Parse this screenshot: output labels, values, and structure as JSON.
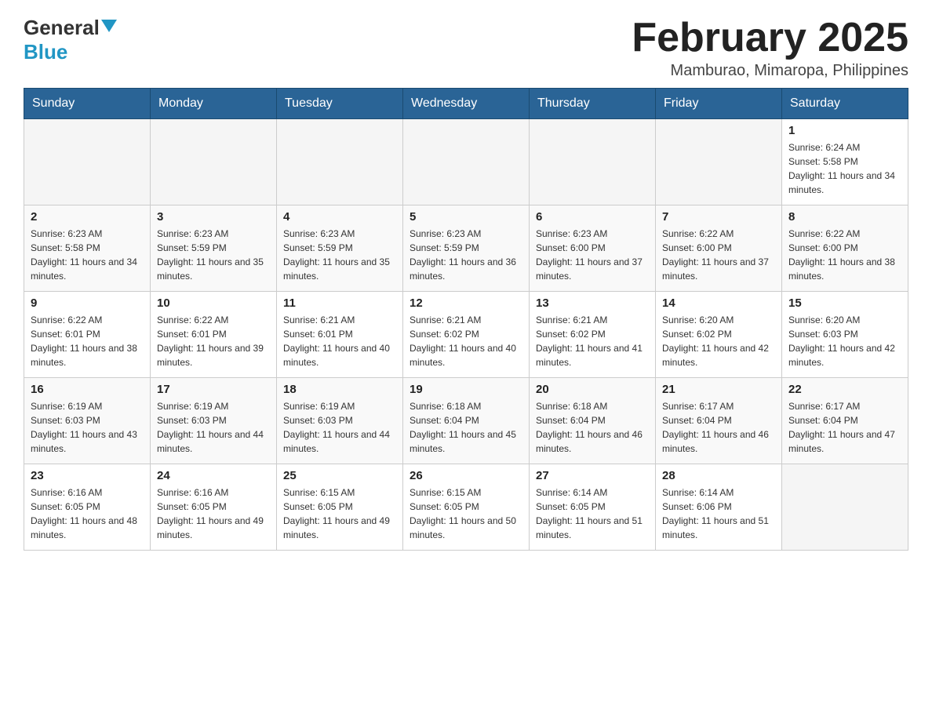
{
  "header": {
    "logo": {
      "word1": "General",
      "word2": "Blue"
    },
    "title": "February 2025",
    "location": "Mamburao, Mimaropa, Philippines"
  },
  "weekdays": [
    "Sunday",
    "Monday",
    "Tuesday",
    "Wednesday",
    "Thursday",
    "Friday",
    "Saturday"
  ],
  "weeks": [
    [
      {
        "day": "",
        "info": ""
      },
      {
        "day": "",
        "info": ""
      },
      {
        "day": "",
        "info": ""
      },
      {
        "day": "",
        "info": ""
      },
      {
        "day": "",
        "info": ""
      },
      {
        "day": "",
        "info": ""
      },
      {
        "day": "1",
        "info": "Sunrise: 6:24 AM\nSunset: 5:58 PM\nDaylight: 11 hours and 34 minutes."
      }
    ],
    [
      {
        "day": "2",
        "info": "Sunrise: 6:23 AM\nSunset: 5:58 PM\nDaylight: 11 hours and 34 minutes."
      },
      {
        "day": "3",
        "info": "Sunrise: 6:23 AM\nSunset: 5:59 PM\nDaylight: 11 hours and 35 minutes."
      },
      {
        "day": "4",
        "info": "Sunrise: 6:23 AM\nSunset: 5:59 PM\nDaylight: 11 hours and 35 minutes."
      },
      {
        "day": "5",
        "info": "Sunrise: 6:23 AM\nSunset: 5:59 PM\nDaylight: 11 hours and 36 minutes."
      },
      {
        "day": "6",
        "info": "Sunrise: 6:23 AM\nSunset: 6:00 PM\nDaylight: 11 hours and 37 minutes."
      },
      {
        "day": "7",
        "info": "Sunrise: 6:22 AM\nSunset: 6:00 PM\nDaylight: 11 hours and 37 minutes."
      },
      {
        "day": "8",
        "info": "Sunrise: 6:22 AM\nSunset: 6:00 PM\nDaylight: 11 hours and 38 minutes."
      }
    ],
    [
      {
        "day": "9",
        "info": "Sunrise: 6:22 AM\nSunset: 6:01 PM\nDaylight: 11 hours and 38 minutes."
      },
      {
        "day": "10",
        "info": "Sunrise: 6:22 AM\nSunset: 6:01 PM\nDaylight: 11 hours and 39 minutes."
      },
      {
        "day": "11",
        "info": "Sunrise: 6:21 AM\nSunset: 6:01 PM\nDaylight: 11 hours and 40 minutes."
      },
      {
        "day": "12",
        "info": "Sunrise: 6:21 AM\nSunset: 6:02 PM\nDaylight: 11 hours and 40 minutes."
      },
      {
        "day": "13",
        "info": "Sunrise: 6:21 AM\nSunset: 6:02 PM\nDaylight: 11 hours and 41 minutes."
      },
      {
        "day": "14",
        "info": "Sunrise: 6:20 AM\nSunset: 6:02 PM\nDaylight: 11 hours and 42 minutes."
      },
      {
        "day": "15",
        "info": "Sunrise: 6:20 AM\nSunset: 6:03 PM\nDaylight: 11 hours and 42 minutes."
      }
    ],
    [
      {
        "day": "16",
        "info": "Sunrise: 6:19 AM\nSunset: 6:03 PM\nDaylight: 11 hours and 43 minutes."
      },
      {
        "day": "17",
        "info": "Sunrise: 6:19 AM\nSunset: 6:03 PM\nDaylight: 11 hours and 44 minutes."
      },
      {
        "day": "18",
        "info": "Sunrise: 6:19 AM\nSunset: 6:03 PM\nDaylight: 11 hours and 44 minutes."
      },
      {
        "day": "19",
        "info": "Sunrise: 6:18 AM\nSunset: 6:04 PM\nDaylight: 11 hours and 45 minutes."
      },
      {
        "day": "20",
        "info": "Sunrise: 6:18 AM\nSunset: 6:04 PM\nDaylight: 11 hours and 46 minutes."
      },
      {
        "day": "21",
        "info": "Sunrise: 6:17 AM\nSunset: 6:04 PM\nDaylight: 11 hours and 46 minutes."
      },
      {
        "day": "22",
        "info": "Sunrise: 6:17 AM\nSunset: 6:04 PM\nDaylight: 11 hours and 47 minutes."
      }
    ],
    [
      {
        "day": "23",
        "info": "Sunrise: 6:16 AM\nSunset: 6:05 PM\nDaylight: 11 hours and 48 minutes."
      },
      {
        "day": "24",
        "info": "Sunrise: 6:16 AM\nSunset: 6:05 PM\nDaylight: 11 hours and 49 minutes."
      },
      {
        "day": "25",
        "info": "Sunrise: 6:15 AM\nSunset: 6:05 PM\nDaylight: 11 hours and 49 minutes."
      },
      {
        "day": "26",
        "info": "Sunrise: 6:15 AM\nSunset: 6:05 PM\nDaylight: 11 hours and 50 minutes."
      },
      {
        "day": "27",
        "info": "Sunrise: 6:14 AM\nSunset: 6:05 PM\nDaylight: 11 hours and 51 minutes."
      },
      {
        "day": "28",
        "info": "Sunrise: 6:14 AM\nSunset: 6:06 PM\nDaylight: 11 hours and 51 minutes."
      },
      {
        "day": "",
        "info": ""
      }
    ]
  ]
}
